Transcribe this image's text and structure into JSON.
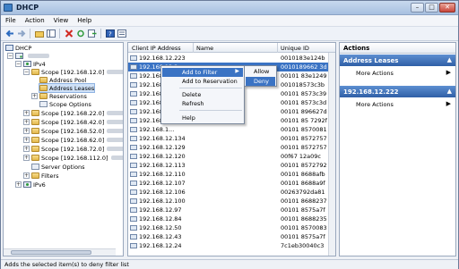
{
  "window": {
    "title": "DHCP",
    "minimize_glyph": "–",
    "maximize_glyph": "□",
    "close_glyph": "✕"
  },
  "menu": [
    "File",
    "Action",
    "View",
    "Help"
  ],
  "toolbar_icons": [
    "back-icon",
    "forward-icon",
    "up-folder-icon",
    "show-tree-icon",
    "delete-icon",
    "refresh-icon",
    "export-icon",
    "help-icon",
    "properties-icon"
  ],
  "tree": {
    "root": "DHCP",
    "ipv4": "IPv4",
    "scope1": "Scope [192.168.12.0]",
    "address_pool": "Address Pool",
    "address_leases": "Address Leases",
    "reservations": "Reservations",
    "scope_options": "Scope Options",
    "scope2": "Scope [192.168.22.0]",
    "scope3": "Scope [192.168.42.0]",
    "scope4": "Scope [192.168.52.0]",
    "scope5": "Scope [192.168.62.0]",
    "scope6": "Scope [192.168.72.0]",
    "scope7": "Scope [192.168.112.0]",
    "server_options": "Server Options",
    "filters": "Filters",
    "ipv6": "IPv6"
  },
  "list": {
    "columns": [
      "Client IP Address",
      "Name",
      "Unique ID"
    ],
    "rows": [
      {
        "ip": "192.168.12.223",
        "uid": "0010183e124b"
      },
      {
        "ip": "192.168.12.2...",
        "uid": "0010189662 3d"
      },
      {
        "ip": "192.168.1...",
        "uid": "00101 83e1249"
      },
      {
        "ip": "192.168.1...",
        "uid": "001018573c3b"
      },
      {
        "ip": "192.168.1...",
        "uid": "00101 8573c39"
      },
      {
        "ip": "192.168.1...",
        "uid": "00101 8573c3d"
      },
      {
        "ip": "192.168.1...",
        "uid": "00101 896627d"
      },
      {
        "ip": "192.168.1...",
        "uid": "00101 85 7292f"
      },
      {
        "ip": "192.168.1...",
        "uid": "00101 8570081"
      },
      {
        "ip": "192.168.12.134",
        "uid": "00101 8572757"
      },
      {
        "ip": "192.168.12.129",
        "uid": "00101 8572757"
      },
      {
        "ip": "192.168.12.120",
        "uid": "00f67 12a09c"
      },
      {
        "ip": "192.168.12.113",
        "uid": "00101 8572792"
      },
      {
        "ip": "192.168.12.110",
        "uid": "00101 8688afb"
      },
      {
        "ip": "192.168.12.107",
        "uid": "00101 8688a9f"
      },
      {
        "ip": "192.168.12.106",
        "uid": "00263792da81"
      },
      {
        "ip": "192.168.12.100",
        "uid": "00101 8688237"
      },
      {
        "ip": "192.168.12.97",
        "uid": "00101 8575a7f"
      },
      {
        "ip": "192.168.12.84",
        "uid": "00101 8688235"
      },
      {
        "ip": "192.168.12.50",
        "uid": "00101 8570083"
      },
      {
        "ip": "192.168.12.43",
        "uid": "00101 8575a7f"
      },
      {
        "ip": "192.168.12.24",
        "uid": "7c1eb30040c3"
      }
    ]
  },
  "context_menu": {
    "add_to_filter": "Add to Filter",
    "add_to_reservation": "Add to Reservation",
    "delete": "Delete",
    "refresh": "Refresh",
    "help": "Help",
    "submenu_arrow": "▶",
    "allow": "Allow",
    "deny": "Deny"
  },
  "actions": {
    "title": "Actions",
    "section1": "Address Leases",
    "section1_item": "More Actions",
    "section2": "192.168.12.222",
    "section2_item": "More Actions",
    "collapse_glyph": "▲",
    "arrow_glyph": "▶"
  },
  "status": "Adds the selected item(s) to deny filter list"
}
